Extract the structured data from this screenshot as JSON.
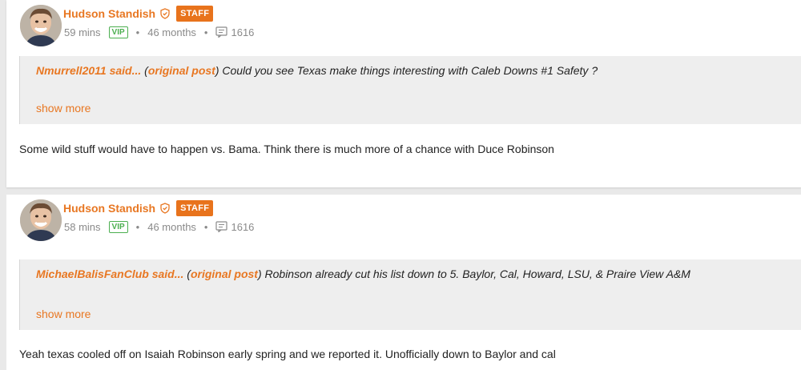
{
  "posts": [
    {
      "author": "Hudson Standish",
      "badge": "STAFF",
      "time": "59 mins",
      "vip": "VIP",
      "tenure": "46 months",
      "post_count": "1616",
      "quote": {
        "user": "Nmurrell2011 said...",
        "open_paren": " (",
        "link": "original post",
        "text": ") Could you see Texas make things interesting with Caleb Downs #1 Safety ?",
        "show_more": "show more"
      },
      "body": "Some wild stuff would have to happen vs. Bama. Think there is much more of a chance with Duce Robinson"
    },
    {
      "author": "Hudson Standish",
      "badge": "STAFF",
      "time": "58 mins",
      "vip": "VIP",
      "tenure": "46 months",
      "post_count": "1616",
      "quote": {
        "user": "MichaelBalisFanClub said...",
        "open_paren": " (",
        "link": "original post",
        "text": ") Robinson already cut his list down to 5. Baylor, Cal, Howard, LSU, & Praire View A&M",
        "show_more": "show more"
      },
      "body": "Yeah texas cooled off on Isaiah Robinson early spring and we reported it. Unofficially down to Baylor and cal"
    }
  ],
  "separators": {
    "dot": "•"
  },
  "colors": {
    "accent": "#e87722",
    "vip": "#4caf50",
    "staff_bg": "#e8731c"
  },
  "icons": {
    "badge": "shield-icon",
    "posts": "message-icon"
  }
}
